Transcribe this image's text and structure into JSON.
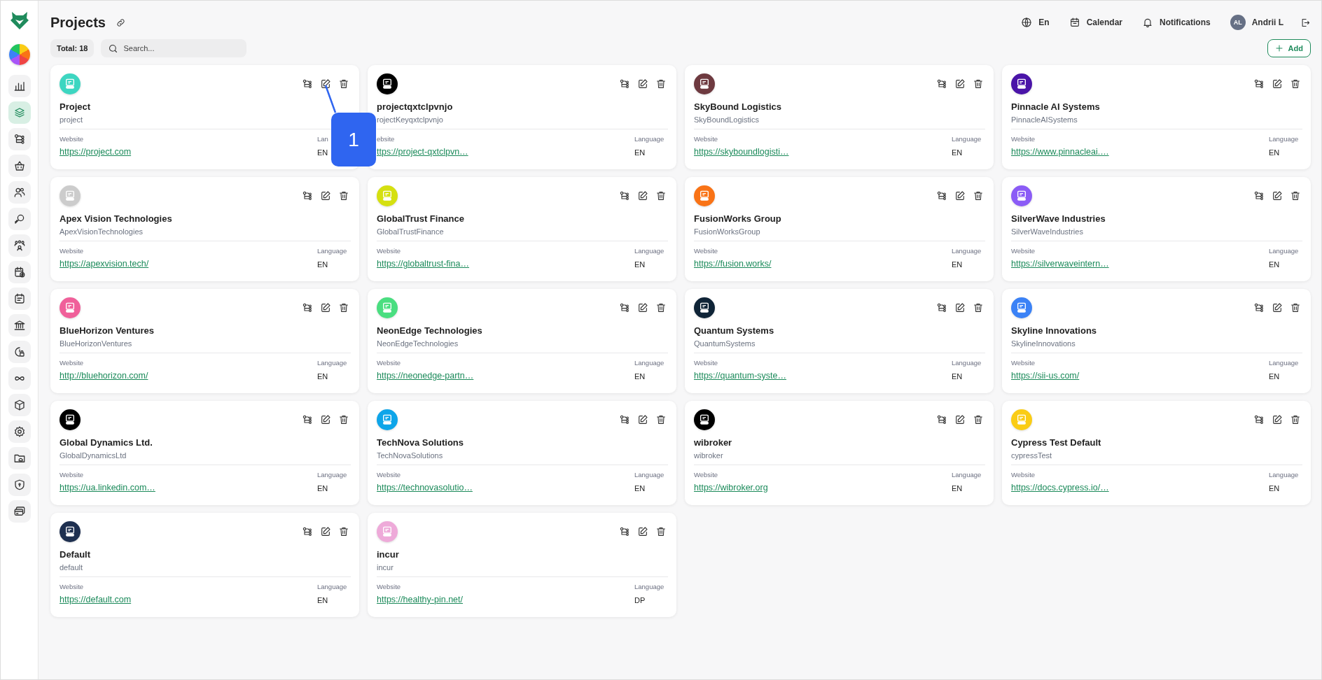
{
  "sidebar": {
    "items": [
      {
        "selected": false
      },
      {
        "selected": true
      },
      {
        "selected": false
      },
      {
        "selected": false
      },
      {
        "selected": false
      },
      {
        "selected": false
      },
      {
        "selected": false
      },
      {
        "selected": false
      },
      {
        "selected": false
      },
      {
        "selected": false
      },
      {
        "selected": false
      },
      {
        "selected": false
      },
      {
        "selected": false
      },
      {
        "selected": false
      },
      {
        "selected": false
      },
      {
        "selected": false
      },
      {
        "selected": false
      }
    ]
  },
  "header": {
    "title": "Projects",
    "language": "En",
    "calendar": "Calendar",
    "notifications": "Notifications",
    "user_initials": "AL",
    "user_name": "Andrii L"
  },
  "toolbar": {
    "total": "Total: 18",
    "search": {
      "placeholder": "Search..."
    },
    "add_button": "Add"
  },
  "projects": [
    {
      "name": "Project",
      "key": "project",
      "website_label": "Website",
      "url": "https://project.com",
      "language_label": "Lan",
      "language": "EN",
      "color": "#3dd6c1"
    },
    {
      "name": "projectqxtclpvnjo",
      "key": "rojectKeyqxtclpvnjo",
      "website_label": "ebsite",
      "url": "ttps://project-qxtclpvn…",
      "language_label": "Language",
      "language": "EN",
      "color": "#000000"
    },
    {
      "name": "SkyBound Logistics",
      "key": "SkyBoundLogistics",
      "website_label": "Website",
      "url": "https://skyboundlogisti…",
      "language_label": "Language",
      "language": "EN",
      "color": "#6e3a40"
    },
    {
      "name": "Pinnacle AI Systems",
      "key": "PinnacleAISystems",
      "website_label": "Website",
      "url": "https://www.pinnacleai.…",
      "language_label": "Language",
      "language": "EN",
      "color": "#4a14a8"
    },
    {
      "name": "Apex Vision Technologies",
      "key": "ApexVisionTechnologies",
      "website_label": "Website",
      "url": "https://apexvision.tech/",
      "language_label": "Language",
      "language": "EN",
      "color": "#cccccc"
    },
    {
      "name": "GlobalTrust Finance",
      "key": "GlobalTrustFinance",
      "website_label": "Website",
      "url": "https://globaltrust-fina…",
      "language_label": "Language",
      "language": "EN",
      "color": "#d5e010"
    },
    {
      "name": "FusionWorks Group",
      "key": "FusionWorksGroup",
      "website_label": "Website",
      "url": "https://fusion.works/",
      "language_label": "Language",
      "language": "EN",
      "color": "#f97316"
    },
    {
      "name": "SilverWave Industries",
      "key": "SilverWaveIndustries",
      "website_label": "Website",
      "url": "https://silverwaveintern…",
      "language_label": "Language",
      "language": "EN",
      "color": "#8b5cf6"
    },
    {
      "name": "BlueHorizon Ventures",
      "key": "BlueHorizonVentures",
      "website_label": "Website",
      "url": "http://bluehorizon.com/",
      "language_label": "Language",
      "language": "EN",
      "color": "#f0609a"
    },
    {
      "name": "NeonEdge Technologies",
      "key": "NeonEdgeTechnologies",
      "website_label": "Website",
      "url": "https://neonedge-partn…",
      "language_label": "Language",
      "language": "EN",
      "color": "#4ade80"
    },
    {
      "name": "Quantum Systems",
      "key": "QuantumSystems",
      "website_label": "Website",
      "url": "https://quantum-syste…",
      "language_label": "Language",
      "language": "EN",
      "color": "#0f2437"
    },
    {
      "name": "Skyline Innovations",
      "key": "SkylineInnovations",
      "website_label": "Website",
      "url": "https://sii-us.com/",
      "language_label": "Language",
      "language": "EN",
      "color": "#3b82f6"
    },
    {
      "name": "Global Dynamics Ltd.",
      "key": "GlobalDynamicsLtd",
      "website_label": "Website",
      "url": "https://ua.linkedin.com…",
      "language_label": "Language",
      "language": "EN",
      "color": "#000000"
    },
    {
      "name": "TechNova Solutions",
      "key": "TechNovaSolutions",
      "website_label": "Website",
      "url": "https://technovasolutio…",
      "language_label": "Language",
      "language": "EN",
      "color": "#0ea5e9"
    },
    {
      "name": "wibroker",
      "key": "wibroker",
      "website_label": "Website",
      "url": "https://wibroker.org",
      "language_label": "Language",
      "language": "EN",
      "color": "#000000"
    },
    {
      "name": "Cypress Test Default",
      "key": "cypressTest",
      "website_label": "Website",
      "url": "https://docs.cypress.io/…",
      "language_label": "Language",
      "language": "EN",
      "color": "#facc15"
    },
    {
      "name": "Default",
      "key": "default",
      "website_label": "Website",
      "url": "https://default.com",
      "language_label": "Language",
      "language": "EN",
      "color": "#1e3050"
    },
    {
      "name": "incur",
      "key": "incur",
      "website_label": "Website",
      "url": "https://healthy-pin.net/",
      "language_label": "Language",
      "language": "DP",
      "color": "#eeaad9"
    }
  ],
  "callouts": [
    {
      "label": "1"
    }
  ]
}
